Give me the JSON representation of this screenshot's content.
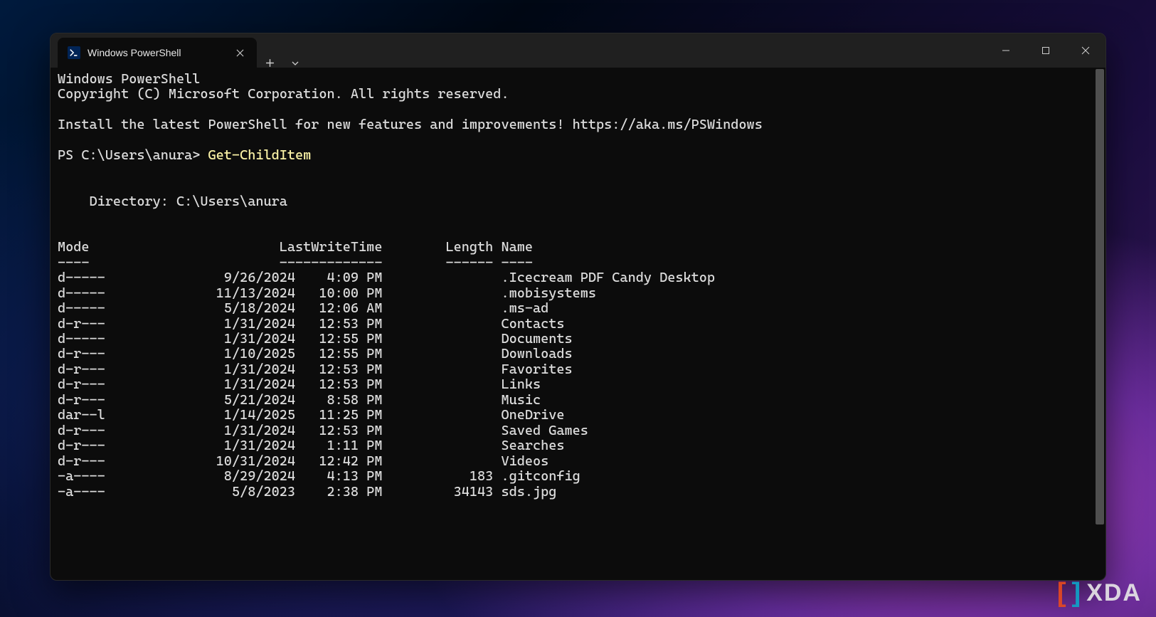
{
  "tab": {
    "title": "Windows PowerShell"
  },
  "header": {
    "line1": "Windows PowerShell",
    "line2": "Copyright (C) Microsoft Corporation. All rights reserved.",
    "install_msg": "Install the latest PowerShell for new features and improvements! https://aka.ms/PSWindows"
  },
  "prompt": {
    "prefix": "PS C:\\Users\\anura> ",
    "command": "Get-ChildItem"
  },
  "directory_line": "    Directory: C:\\Users\\anura",
  "columns": {
    "mode": "Mode",
    "lastwrite": "LastWriteTime",
    "length": "Length",
    "name": "Name"
  },
  "separators": {
    "mode": "----",
    "lastwrite": "-------------",
    "length": "------",
    "name": "----"
  },
  "rows": [
    {
      "mode": "d-----",
      "date": "9/26/2024",
      "time": "4:09 PM",
      "length": "",
      "name": ".Icecream PDF Candy Desktop"
    },
    {
      "mode": "d-----",
      "date": "11/13/2024",
      "time": "10:00 PM",
      "length": "",
      "name": ".mobisystems"
    },
    {
      "mode": "d-----",
      "date": "5/18/2024",
      "time": "12:06 AM",
      "length": "",
      "name": ".ms-ad"
    },
    {
      "mode": "d-r---",
      "date": "1/31/2024",
      "time": "12:53 PM",
      "length": "",
      "name": "Contacts"
    },
    {
      "mode": "d-----",
      "date": "1/31/2024",
      "time": "12:55 PM",
      "length": "",
      "name": "Documents"
    },
    {
      "mode": "d-r---",
      "date": "1/10/2025",
      "time": "12:55 PM",
      "length": "",
      "name": "Downloads"
    },
    {
      "mode": "d-r---",
      "date": "1/31/2024",
      "time": "12:53 PM",
      "length": "",
      "name": "Favorites"
    },
    {
      "mode": "d-r---",
      "date": "1/31/2024",
      "time": "12:53 PM",
      "length": "",
      "name": "Links"
    },
    {
      "mode": "d-r---",
      "date": "5/21/2024",
      "time": "8:58 PM",
      "length": "",
      "name": "Music"
    },
    {
      "mode": "dar--l",
      "date": "1/14/2025",
      "time": "11:25 PM",
      "length": "",
      "name": "OneDrive"
    },
    {
      "mode": "d-r---",
      "date": "1/31/2024",
      "time": "12:53 PM",
      "length": "",
      "name": "Saved Games"
    },
    {
      "mode": "d-r---",
      "date": "1/31/2024",
      "time": "1:11 PM",
      "length": "",
      "name": "Searches"
    },
    {
      "mode": "d-r---",
      "date": "10/31/2024",
      "time": "12:42 PM",
      "length": "",
      "name": "Videos"
    },
    {
      "mode": "-a----",
      "date": "8/29/2024",
      "time": "4:13 PM",
      "length": "183",
      "name": ".gitconfig"
    },
    {
      "mode": "-a----",
      "date": "5/8/2023",
      "time": "2:38 PM",
      "length": "34143",
      "name": "sds.jpg"
    }
  ],
  "watermark": {
    "text": "XDA"
  }
}
